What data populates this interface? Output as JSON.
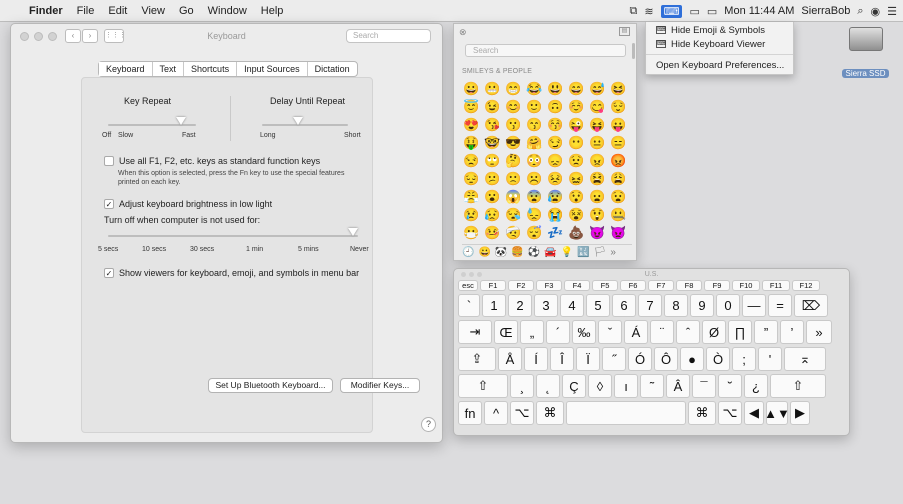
{
  "menubar": {
    "apple": "",
    "items": [
      "Finder",
      "File",
      "Edit",
      "View",
      "Go",
      "Window",
      "Help"
    ],
    "right_time": "Mon 11:44 AM",
    "right_user": "SierraBob",
    "right_icons": [
      "display-icon",
      "wifi-icon",
      "input-menu-icon",
      "airplay-icon",
      "battery-icon",
      "search-icon",
      "siri-icon",
      "list-icon"
    ]
  },
  "dropdown": {
    "items": [
      "Hide Emoji & Symbols",
      "Hide Keyboard Viewer"
    ],
    "extra": "Open Keyboard Preferences..."
  },
  "desktop": {
    "drive_label": "Sierra SSD"
  },
  "prefs": {
    "title": "Keyboard",
    "search_placeholder": "Search",
    "tabs": [
      "Keyboard",
      "Text",
      "Shortcuts",
      "Input Sources",
      "Dictation"
    ],
    "key_repeat": {
      "label": "Key Repeat",
      "left": "Off",
      "left2": "Slow",
      "right": "Fast",
      "level": 0.78
    },
    "delay": {
      "label": "Delay Until Repeat",
      "left": "Long",
      "right": "Short",
      "level": 0.6
    },
    "fn_checkbox": {
      "label": "Use all F1, F2, etc. keys as standard function keys",
      "checked": false,
      "note1": "When this option is selected, press the Fn key to use the special features",
      "note2": "printed on each key."
    },
    "brightness_checkbox": {
      "label": "Adjust keyboard brightness in low light",
      "checked": true
    },
    "turnoff": {
      "label": "Turn off when computer is not used for:",
      "ticks": [
        "5 secs",
        "10 secs",
        "30 secs",
        "1 min",
        "5 mins",
        "Never"
      ],
      "level": 1
    },
    "viewers_checkbox": {
      "label": "Show viewers for keyboard, emoji, and symbols in menu bar",
      "checked": true
    },
    "bt_button": "Set Up Bluetooth Keyboard...",
    "mod_button": "Modifier Keys...",
    "help": "?"
  },
  "emoji": {
    "search_placeholder": "Search",
    "category": "SMILEYS & PEOPLE",
    "grid": [
      "😀",
      "😬",
      "😁",
      "😂",
      "😃",
      "😄",
      "😅",
      "😆",
      "😇",
      "😉",
      "😊",
      "🙂",
      "🙃",
      "☺️",
      "😋",
      "😌",
      "😍",
      "😘",
      "😗",
      "😙",
      "😚",
      "😜",
      "😝",
      "😛",
      "🤑",
      "🤓",
      "😎",
      "🤗",
      "😏",
      "😶",
      "😐",
      "😑",
      "😒",
      "🙄",
      "🤔",
      "😳",
      "😞",
      "😟",
      "😠",
      "😡",
      "😔",
      "😕",
      "🙁",
      "☹️",
      "😣",
      "😖",
      "😫",
      "😩",
      "😤",
      "😮",
      "😱",
      "😨",
      "😰",
      "😯",
      "😦",
      "😧",
      "😢",
      "😥",
      "😪",
      "😓",
      "😭",
      "😵",
      "😲",
      "🤐",
      "😷",
      "🤒",
      "🤕",
      "😴",
      "💤",
      "💩",
      "😈",
      "👿",
      "👹",
      "👺",
      "💀",
      "👻",
      "👽",
      "🤖",
      "😺",
      "😸"
    ],
    "cats": [
      "🕘",
      "😀",
      "🐼",
      "🍔",
      "⚽",
      "🚘",
      "💡",
      "🔣",
      "🏳",
      "»"
    ]
  },
  "keyboard": {
    "title": "U.S.",
    "row0": [
      "esc",
      "F1",
      "F2",
      "F3",
      "F4",
      "F5",
      "F6",
      "F7",
      "F8",
      "F9",
      "F10",
      "F11",
      "F12"
    ],
    "row1": [
      "`",
      "1",
      "2",
      "3",
      "4",
      "5",
      "6",
      "7",
      "8",
      "9",
      "0",
      "—",
      "=",
      "⌦"
    ],
    "row2": [
      "⇥",
      "Œ",
      "„",
      "´",
      "‰",
      "ˇ",
      "Á",
      "¨",
      "ˆ",
      "Ø",
      "∏",
      "”",
      "’",
      "»"
    ],
    "row3": [
      "⇪",
      "Å",
      "Í",
      "Î",
      "Ï",
      "˝",
      "Ó",
      "Ô",
      "",
      "Ò",
      ";",
      "'",
      "⌅"
    ],
    "row4": [
      "⇧",
      "¸",
      "˛",
      "Ç",
      "◊",
      "ı",
      "˜",
      "Â",
      "¯",
      "˘",
      "¿",
      "⇧"
    ],
    "row5": [
      "fn",
      "^",
      "⌥",
      "⌘",
      "",
      "⌘",
      "⌥",
      "◀",
      "▲▼",
      "▶"
    ]
  }
}
